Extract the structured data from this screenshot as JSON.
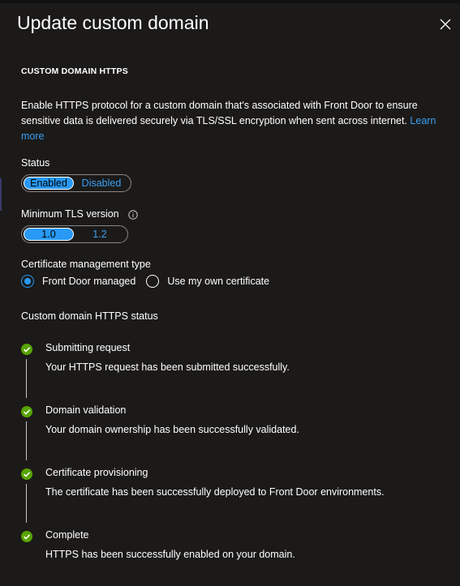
{
  "panel": {
    "title": "Update custom domain",
    "close_icon": "close-icon"
  },
  "section": {
    "heading": "CUSTOM DOMAIN HTTPS",
    "description": "Enable HTTPS protocol for a custom domain that's associated with Front Door to ensure sensitive data is delivered securely via TLS/SSL encryption when sent across internet. ",
    "learn_more": "Learn more",
    "link_color": "#3aa0f3"
  },
  "status": {
    "label": "Status",
    "options": [
      "Enabled",
      "Disabled"
    ],
    "selected": "Enabled"
  },
  "tls": {
    "label": "Minimum TLS version",
    "info_icon": "info-icon",
    "options": [
      "1.0",
      "1.2"
    ],
    "selected": "1.0"
  },
  "certificate": {
    "label": "Certificate management type",
    "options": [
      "Front Door managed",
      "Use my own certificate"
    ],
    "selected": "Front Door managed"
  },
  "https_status": {
    "label": "Custom domain HTTPS status",
    "steps": [
      {
        "title": "Submitting request",
        "text": "Your HTTPS request has been submitted successfully."
      },
      {
        "title": "Domain validation",
        "text": "Your domain ownership has been successfully validated."
      },
      {
        "title": "Certificate provisioning",
        "text": "The certificate has been successfully deployed to Front Door environments."
      },
      {
        "title": "Complete",
        "text": "HTTPS has been successfully enabled on your domain."
      }
    ],
    "success_color": "#57a300"
  },
  "accent_color": "#2899f5"
}
